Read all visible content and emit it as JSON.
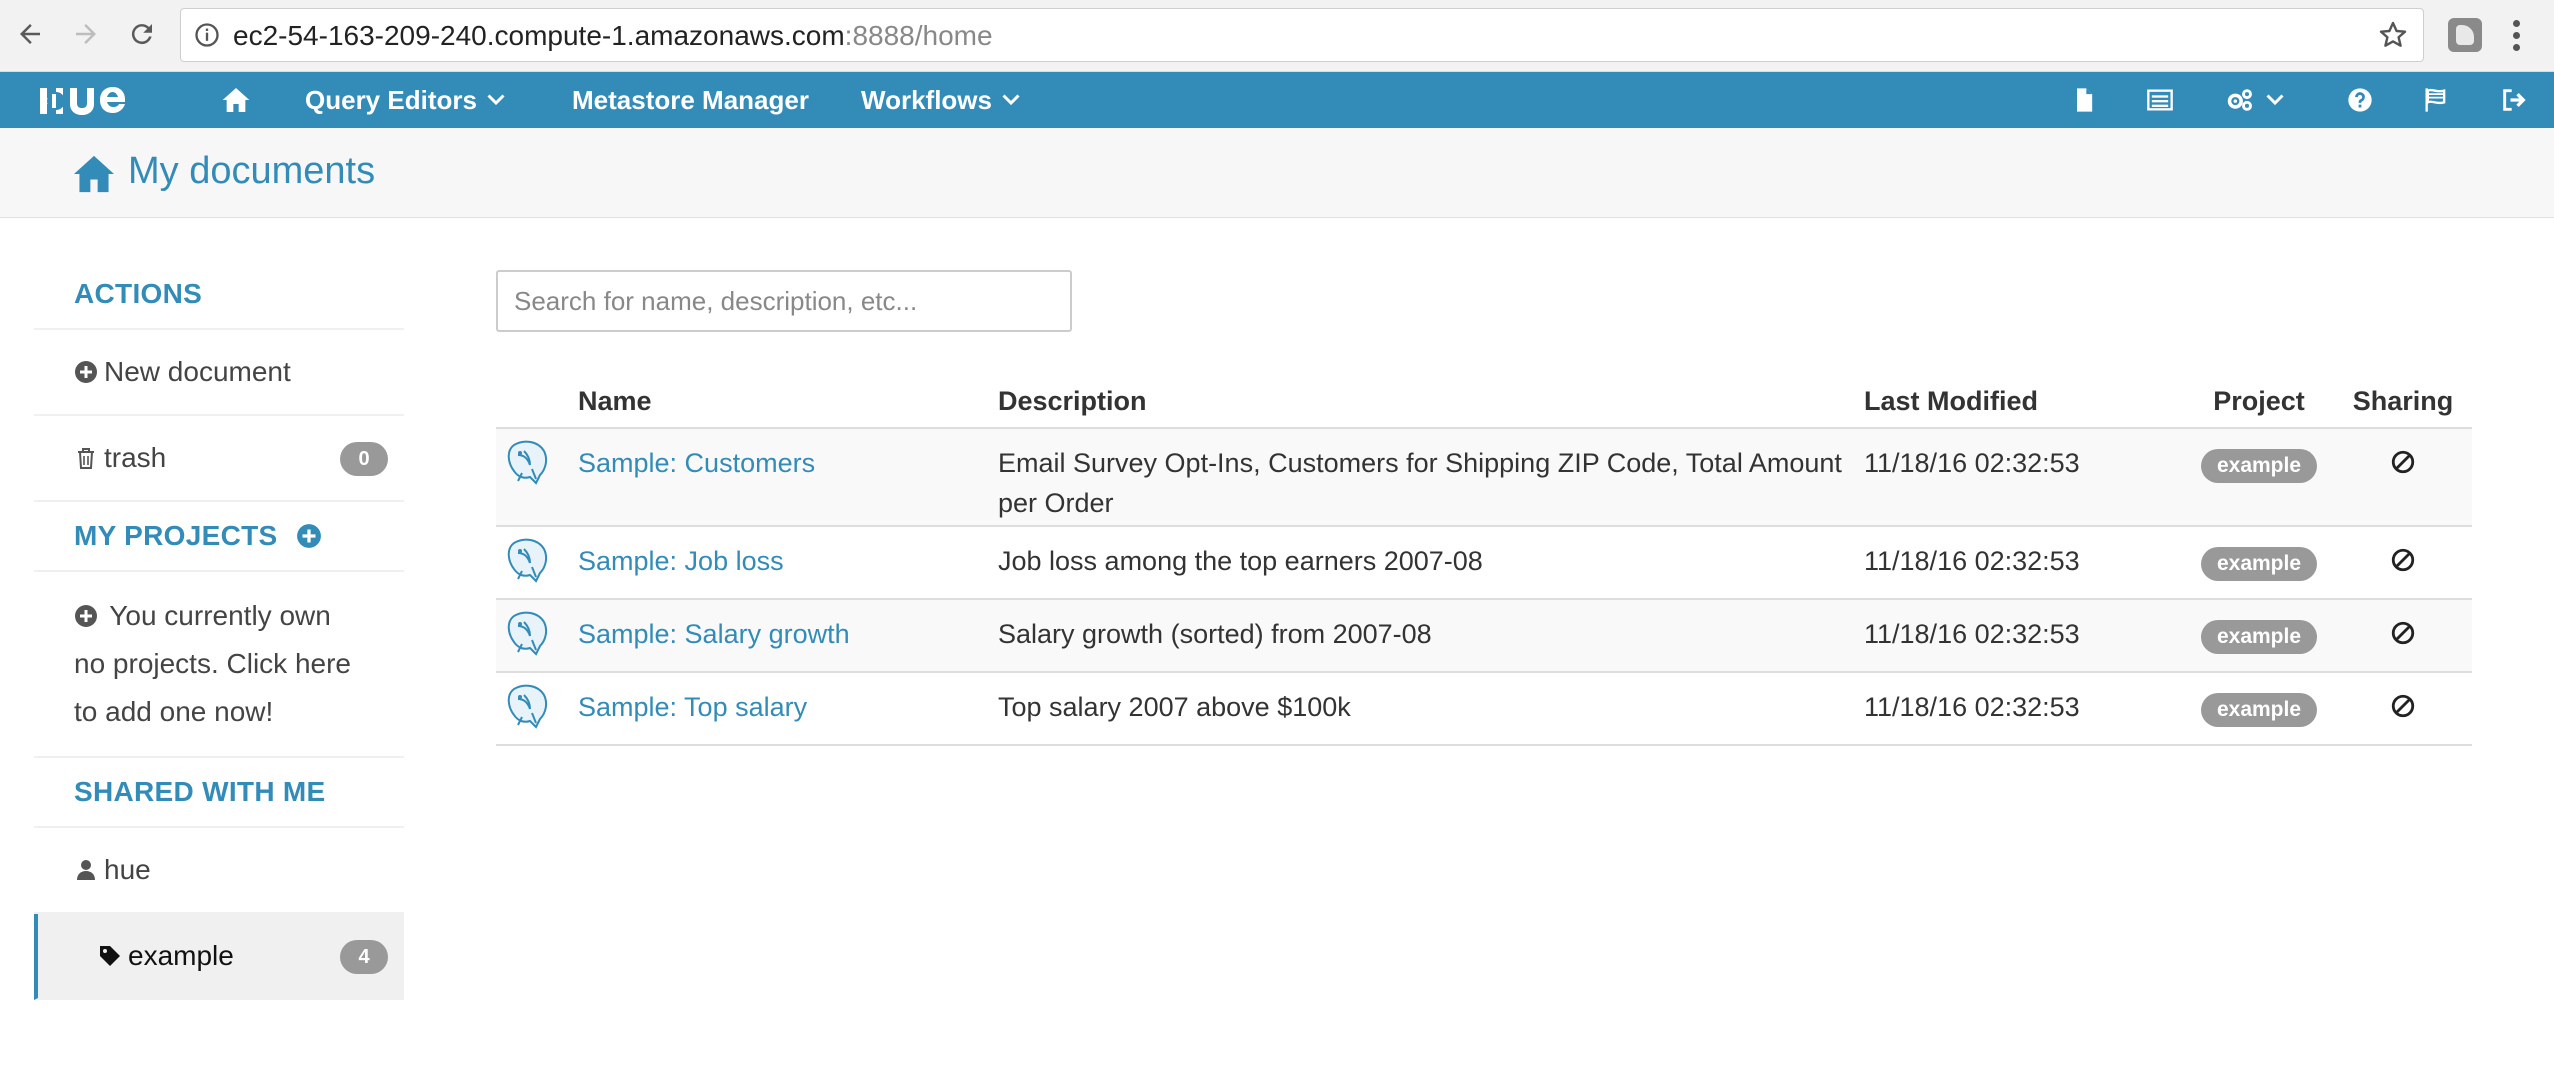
{
  "browser": {
    "url_host": "ec2-54-163-209-240.compute-1.amazonaws.com",
    "url_rest": ":8888/home"
  },
  "topnav": {
    "logo_alt": "HUE",
    "query_editors": "Query Editors",
    "metastore": "Metastore Manager",
    "workflows": "Workflows"
  },
  "page": {
    "title": "My documents"
  },
  "sidebar": {
    "actions_head": "ACTIONS",
    "new_document": "New document",
    "trash": "trash",
    "trash_count": "0",
    "projects_head": "MY PROJECTS",
    "projects_note": "You currently own no projects. Click here to add one now!",
    "shared_head": "SHARED WITH ME",
    "shared_user": "hue",
    "shared_tag": "example",
    "shared_tag_count": "4"
  },
  "search": {
    "placeholder": "Search for name, description, etc...",
    "value": ""
  },
  "table": {
    "headers": {
      "name": "Name",
      "description": "Description",
      "last_modified": "Last Modified",
      "project": "Project",
      "sharing": "Sharing"
    },
    "rows": [
      {
        "name": "Sample: Customers",
        "description": "Email Survey Opt-Ins, Customers for Shipping ZIP Code, Total Amount per Order",
        "modified": "11/18/16 02:32:53",
        "project": "example"
      },
      {
        "name": "Sample: Job loss",
        "description": "Job loss among the top earners 2007-08",
        "modified": "11/18/16 02:32:53",
        "project": "example"
      },
      {
        "name": "Sample: Salary growth",
        "description": "Salary growth (sorted) from 2007-08",
        "modified": "11/18/16 02:32:53",
        "project": "example"
      },
      {
        "name": "Sample: Top salary",
        "description": "Top salary 2007 above $100k",
        "modified": "11/18/16 02:32:53",
        "project": "example"
      }
    ]
  },
  "icons": {
    "back": "back-arrow-icon",
    "forward": "forward-arrow-icon",
    "reload": "reload-icon",
    "home": "home-icon",
    "document": "document-icon",
    "hive": "hive-icon",
    "settings": "gears-icon",
    "help": "question-icon",
    "flag": "flag-icon",
    "logout": "logout-icon",
    "sharing": "no-sharing-icon"
  },
  "colors": {
    "brand_blue": "#338bb8",
    "badge_gray": "#999999"
  }
}
